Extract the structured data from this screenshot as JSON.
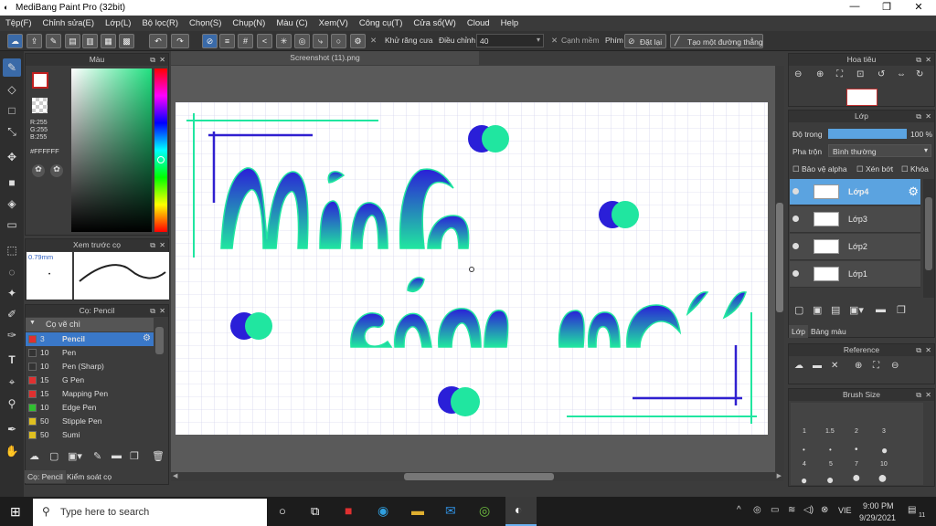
{
  "window": {
    "title": "MediBang Paint Pro (32bit)",
    "min": "—",
    "max": "❐",
    "close": "✕"
  },
  "menu": [
    "Tệp(F)",
    "Chỉnh sửa(E)",
    "Lớp(L)",
    "Bộ lọc(R)",
    "Chọn(S)",
    "Chụp(N)",
    "Màu (C)",
    "Xem(V)",
    "Công cụ(T)",
    "Cửa sổ(W)",
    "Cloud",
    "Help"
  ],
  "toolbar": {
    "antialias": "Khử răng cưa",
    "adjust": "Điều chỉnh",
    "adjust_value": "40",
    "soft_edge": "Cạnh mềm",
    "key": "Phím",
    "reset": "Đặt lại",
    "new_line": "Tạo một đường thẳng"
  },
  "color_panel": {
    "title": "Màu",
    "r": "R:255",
    "g": "G:255",
    "b": "B:255",
    "hex": "#FFFFFF"
  },
  "brush_preview": {
    "title": "Xem trước cọ",
    "size": "0.79mm"
  },
  "brush_panel": {
    "title": "Cọ: Pencil",
    "category": "Cọ vẽ chì",
    "brushes": [
      {
        "size": "3",
        "name": "Pencil",
        "color": "#e03030",
        "selected": true
      },
      {
        "size": "10",
        "name": "Pen",
        "color": "#333333",
        "selected": false
      },
      {
        "size": "10",
        "name": "Pen (Sharp)",
        "color": "#333333",
        "selected": false
      },
      {
        "size": "15",
        "name": "G Pen",
        "color": "#e03030",
        "selected": false
      },
      {
        "size": "15",
        "name": "Mapping Pen",
        "color": "#e03030",
        "selected": false
      },
      {
        "size": "10",
        "name": "Edge Pen",
        "color": "#30c030",
        "selected": false
      },
      {
        "size": "50",
        "name": "Stipple Pen",
        "color": "#e0c020",
        "selected": false
      },
      {
        "size": "50",
        "name": "Sumi",
        "color": "#e0c020",
        "selected": false
      }
    ],
    "tab1": "Cọ: Pencil",
    "tab2": "Kiểm soát cọ"
  },
  "document": {
    "tab": "Screenshot (11).png"
  },
  "navigator": {
    "title": "Hoa tiêu"
  },
  "layer_panel": {
    "title": "Lớp",
    "opacity_label": "Độ trong",
    "opacity_value": "100 %",
    "blend_label": "Pha trộn",
    "blend_value": "Bình thường",
    "protect_alpha": "Bảo vệ alpha",
    "clipping": "Xén bớt",
    "lock": "Khóa",
    "layers": [
      {
        "name": "Lớp4",
        "selected": true
      },
      {
        "name": "Lớp3",
        "selected": false
      },
      {
        "name": "Lớp2",
        "selected": false
      },
      {
        "name": "Lớp1",
        "selected": false
      }
    ],
    "tab1": "Lớp",
    "tab2": "Bảng màu"
  },
  "reference": {
    "title": "Reference"
  },
  "brush_size": {
    "title": "Brush Size",
    "labels": [
      "1",
      "1.5",
      "2",
      "3",
      "4",
      "5",
      "7",
      "10"
    ]
  },
  "taskbar": {
    "search": "Type here to search",
    "lang": "VIE",
    "time": "9:00 PM",
    "date": "9/29/2021",
    "notif": "11"
  }
}
